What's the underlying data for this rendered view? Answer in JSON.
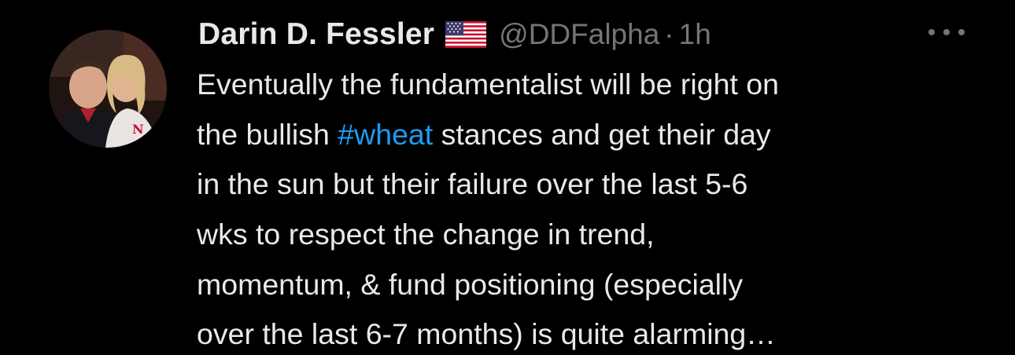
{
  "tweet": {
    "author": {
      "name": "Darin D. Fessler",
      "flag": "🇺🇸",
      "handle": "@DDFalpha",
      "separator": "·",
      "time": "1h"
    },
    "more_icon": "more-horizontal-icon",
    "lines": [
      {
        "text": "Eventually the fundamentalist will be right on"
      },
      {
        "pre": "the bullish ",
        "hashtag": "#wheat",
        "post": " stances and get their day"
      },
      {
        "text": "in the sun but their failure over the last 5-6"
      },
      {
        "text": "wks to respect the change in trend,"
      },
      {
        "text": "momentum, & fund positioning (especially"
      },
      {
        "text": "over the last 6-7 months) is quite alarming…"
      }
    ]
  },
  "colors": {
    "background": "#000000",
    "text": "#e7e9ea",
    "secondary": "#71767b",
    "accent": "#1d9bf0"
  }
}
